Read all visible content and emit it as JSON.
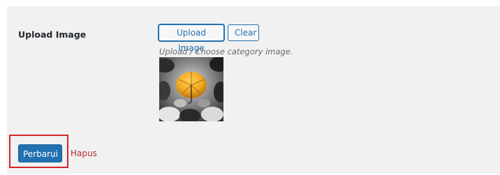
{
  "form": {
    "upload_label": "Upload Image",
    "upload_button": "Upload Image",
    "clear_button": "Clear",
    "description": "Upload / Choose category image."
  },
  "actions": {
    "update_button": "Perbarui",
    "delete_link": "Hapus"
  },
  "colors": {
    "panel_background": "#f1f1f1",
    "primary": "#2271b1",
    "delete": "#b32d2e",
    "highlight": "#d3252a",
    "umbrella": "#f2a922"
  }
}
